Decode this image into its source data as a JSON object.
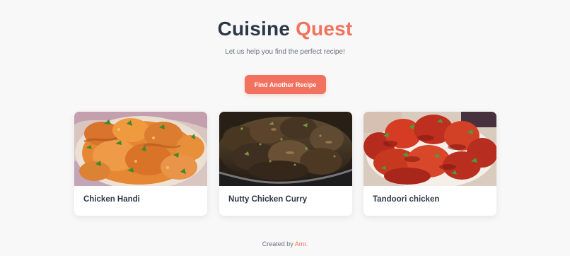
{
  "header": {
    "title_primary": "Cuisine",
    "title_accent": "Quest",
    "subtitle": "Let us help you find the perfect recipe!"
  },
  "actions": {
    "find_another_label": "Find Another Recipe"
  },
  "recipes": [
    {
      "title": "Chicken Handi",
      "image": "chicken-handi-photo"
    },
    {
      "title": "Nutty Chicken Curry",
      "image": "nutty-chicken-curry-photo"
    },
    {
      "title": "Tandoori chicken",
      "image": "tandoori-chicken-photo"
    }
  ],
  "footer": {
    "created_by": "Created by",
    "author": "Amr."
  },
  "colors": {
    "accent": "#f2725f",
    "heading": "#2d3748",
    "muted": "#6b7280",
    "background": "#f8f8f8",
    "card": "#ffffff"
  }
}
